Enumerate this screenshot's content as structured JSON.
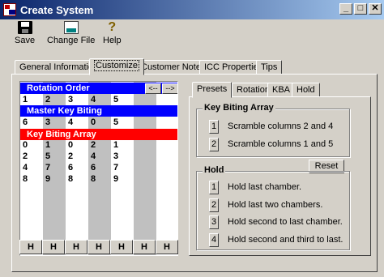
{
  "window": {
    "title": "Create System",
    "minimize": "_",
    "maximize": "□",
    "close": "✕"
  },
  "toolbar": {
    "save": "Save",
    "change_file": "Change File",
    "help": "Help"
  },
  "tabs": [
    "General Information",
    "Customize",
    "Customer Notes",
    "ICC Properties",
    "Tips"
  ],
  "active_tab": "Customize",
  "grid": {
    "rotation_order_label": "Rotation Order",
    "left_arrow": "<--",
    "right_arrow": "-->",
    "rotation_order": [
      "1",
      "2",
      "3",
      "4",
      "5"
    ],
    "master_key_biting_label": "Master Key Biting",
    "master_key_biting": [
      "6",
      "3",
      "4",
      "0",
      "5"
    ],
    "key_biting_array_label": "Key Biting Array",
    "key_biting_array": [
      [
        "0",
        "1",
        "0",
        "2",
        "1"
      ],
      [
        "2",
        "5",
        "2",
        "4",
        "3"
      ],
      [
        "4",
        "7",
        "6",
        "6",
        "7"
      ],
      [
        "8",
        "9",
        "8",
        "8",
        "9"
      ]
    ],
    "hold_buttons": [
      "H",
      "H",
      "H",
      "H",
      "H",
      "H",
      "H"
    ]
  },
  "right_tabs": [
    "Presets",
    "Rotation",
    "KBA",
    "Hold"
  ],
  "active_right_tab": "Presets",
  "kba_group": {
    "title": "Key Biting Array",
    "options": [
      {
        "num": "1",
        "label": "Scramble columns 2 and 4"
      },
      {
        "num": "2",
        "label": "Scramble columns 1 and 5"
      }
    ]
  },
  "reset_label": "Reset",
  "hold_group": {
    "title": "Hold",
    "options": [
      {
        "num": "1",
        "label": "Hold last chamber."
      },
      {
        "num": "2",
        "label": "Hold last two chambers."
      },
      {
        "num": "3",
        "label": "Hold second to last chamber."
      },
      {
        "num": "4",
        "label": "Hold second and third to last."
      }
    ]
  },
  "colors": {
    "title_bar": "#0a246a",
    "bar_blue": "#0000ff",
    "bar_red": "#ff0000",
    "column_shade": "#c0c0c0"
  }
}
